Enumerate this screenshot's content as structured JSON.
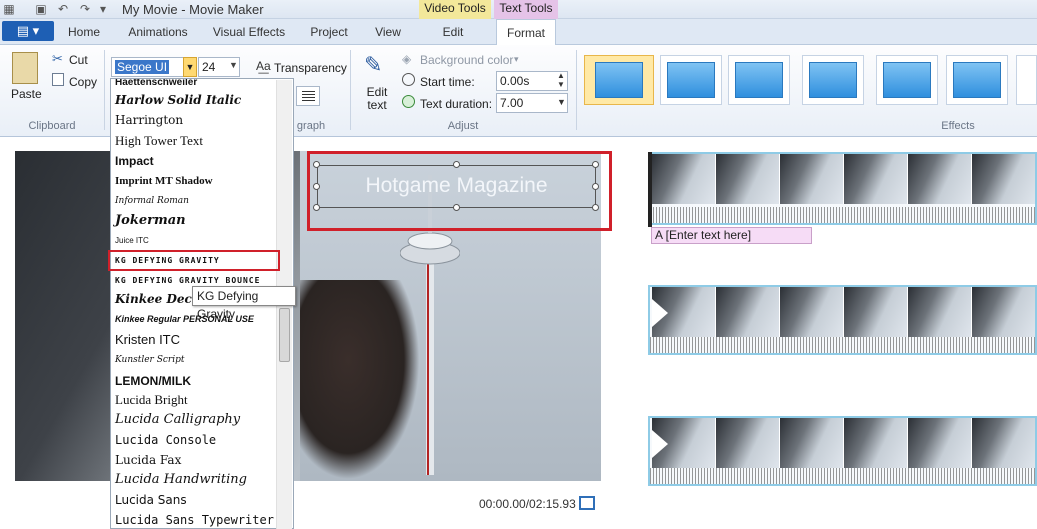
{
  "titlebar": {
    "title": "My Movie - Movie Maker",
    "video_tools": "Video Tools",
    "text_tools": "Text Tools"
  },
  "tabs": {
    "file": "▤ ▾",
    "items": [
      "Home",
      "Animations",
      "Visual Effects",
      "Project",
      "View",
      "Edit",
      "Format"
    ]
  },
  "clipboard": {
    "paste": "Paste",
    "cut": "Cut",
    "copy": "Copy",
    "group_label": "Clipboard"
  },
  "font": {
    "family": "Segoe UI",
    "size": "24",
    "transparency": "Transparency",
    "group_label_partial": "graph"
  },
  "adjust": {
    "edit_text": "Edit text",
    "background_color": "Background color",
    "start_time_label": "Start time:",
    "start_time_value": "0.00s",
    "text_duration_label": "Text duration:",
    "text_duration_value": "7.00",
    "group_label": "Adjust"
  },
  "effects": {
    "group_label": "Effects"
  },
  "preview": {
    "caption": "Hotgame Magazine",
    "time": "00:00.00/02:15.93"
  },
  "storyboard": {
    "text_placeholder": "A [Enter text here]"
  },
  "font_list": {
    "items": [
      "Haettenschweiler",
      "Harlow Solid Italic",
      "Harrington",
      "High Tower Text",
      "Impact",
      "Imprint MT Shadow",
      "Informal Roman",
      "Jokerman",
      "Juice ITC",
      "KG DEFYING GRAVITY",
      "KG DEFYING GRAVITY BOUNCE",
      "Kinkee Decor Personal",
      "Kinkee Regular PERSONAL USE",
      "Kristen ITC",
      "Kunstler Script",
      "LEMON/MILK",
      "Lucida Bright",
      "Lucida Calligraphy",
      "Lucida Console",
      "Lucida Fax",
      "Lucida Handwriting",
      "Lucida Sans",
      "Lucida Sans Typewriter"
    ],
    "tooltip": "KG Defying Gravity"
  },
  "colors": {
    "accent": "#1e5fb4",
    "highlight_red": "#d0202a",
    "video_tools_tab": "#f3e89a",
    "text_tools_tab": "#e5c3e8"
  }
}
